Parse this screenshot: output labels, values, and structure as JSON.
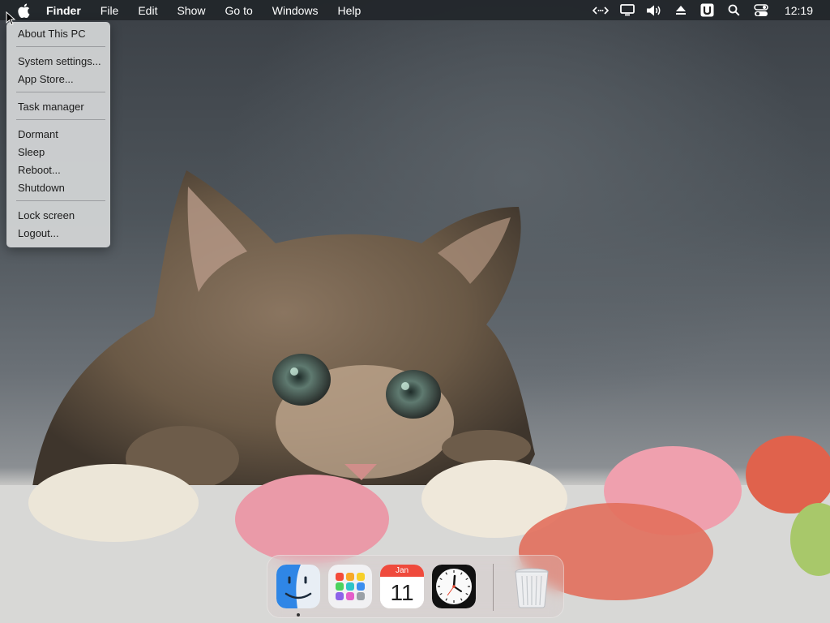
{
  "menubar": {
    "apple_icon": "apple-logo-icon",
    "items": [
      {
        "label": "Finder"
      },
      {
        "label": "File"
      },
      {
        "label": "Edit"
      },
      {
        "label": "Show"
      },
      {
        "label": "Go to"
      },
      {
        "label": "Windows"
      },
      {
        "label": "Help"
      }
    ],
    "status_icons": [
      "remote-connection-icon",
      "display-icon",
      "volume-icon",
      "eject-icon",
      "u-app-icon",
      "search-icon",
      "control-center-icon"
    ],
    "clock": "12:19"
  },
  "apple_menu": {
    "items": [
      {
        "label": "About This PC"
      },
      {
        "label": "System settings..."
      },
      {
        "label": "App Store..."
      },
      {
        "label": "Task manager"
      },
      {
        "label": "Dormant"
      },
      {
        "label": "Sleep"
      },
      {
        "label": "Reboot..."
      },
      {
        "label": "Shutdown"
      },
      {
        "label": "Lock screen"
      },
      {
        "label": "Logout..."
      }
    ]
  },
  "dock": {
    "apps": [
      {
        "icon": "finder-icon",
        "running": true
      },
      {
        "icon": "launchpad-icon",
        "running": false
      },
      {
        "icon": "calendar-icon",
        "running": false,
        "month": "Jan",
        "day": "11"
      },
      {
        "icon": "clock-icon",
        "running": false
      }
    ],
    "trash": {
      "icon": "trash-icon"
    }
  },
  "colors": {
    "menubar_bg": "#22262a",
    "menu_bg": "#d2d4d6",
    "calendar_red": "#ef4a3c",
    "finder_blue": "#2f86e6"
  }
}
